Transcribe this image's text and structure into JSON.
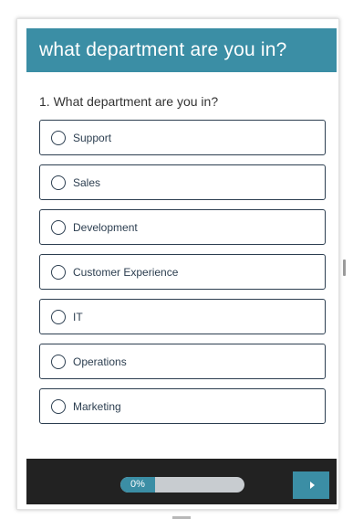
{
  "survey": {
    "title": "what department are you in?",
    "question": "1. What department are you in?",
    "options": [
      {
        "label": "Support"
      },
      {
        "label": "Sales"
      },
      {
        "label": "Development"
      },
      {
        "label": "Customer Experience"
      },
      {
        "label": "IT"
      },
      {
        "label": "Operations"
      },
      {
        "label": "Marketing"
      }
    ]
  },
  "footer": {
    "progress_text": "0%",
    "progress_value": 0,
    "next_icon": "next-arrow-icon"
  },
  "colors": {
    "accent": "#3b8ea5",
    "footer_bg": "#222222",
    "option_border": "#2c3e50",
    "progress_track": "#c8ccd0"
  }
}
